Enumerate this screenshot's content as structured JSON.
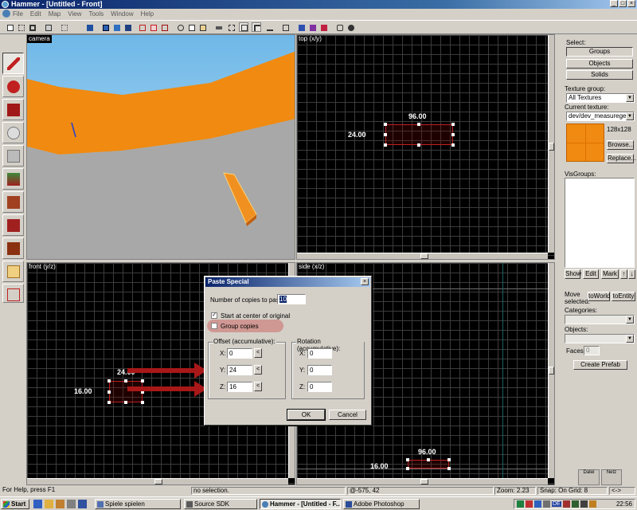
{
  "window": {
    "title": "Hammer - [Untitled - Front]",
    "min": "_",
    "max": "□",
    "close": "×"
  },
  "menu": [
    "File",
    "Edit",
    "Map",
    "View",
    "Tools",
    "Window",
    "Help"
  ],
  "viewports": {
    "camera": {
      "label": "camera"
    },
    "top": {
      "label": "top (x/y)",
      "width_label": "96.00",
      "height_label": "24.00"
    },
    "front": {
      "label": "front (y/z)",
      "width_label": "24.00",
      "height_label": "16.00"
    },
    "side": {
      "label": "side (x/z)",
      "width_label": "96.00",
      "height_label": "16.00"
    }
  },
  "right_panel": {
    "select_label": "Select:",
    "groups": "Groups",
    "objects": "Objects",
    "solids": "Solids",
    "texture_group_label": "Texture group:",
    "texture_group_value": "All Textures",
    "current_texture_label": "Current texture:",
    "current_texture_value": "dev/dev_measuregene",
    "texture_size": "128x128",
    "texture_color": "#f08a10",
    "browse": "Browse...",
    "replace": "Replace...",
    "visgroups_label": "VisGroups:",
    "show": "Show",
    "edit": "Edit",
    "mark": "Mark",
    "up": "↑",
    "down": "↓",
    "move_selected": "Move selected:",
    "to_world": "toWorld",
    "to_entity": "toEntity",
    "categories_label": "Categories:",
    "objects_label": "Objects:",
    "faces_label": "Faces:",
    "faces_value": "0",
    "create_prefab": "Create Prefab",
    "mini_tab_1": "Datei",
    "mini_tab_2": "Netz"
  },
  "dialog": {
    "title": "Paste Special",
    "close": "×",
    "copies_label": "Number of copies to paste:",
    "copies_value": "10",
    "start_center_label": "Start at center of original",
    "start_center_checked": true,
    "group_copies_label": "Group copies",
    "group_copies_checked": false,
    "offset_title": "Offset (accumulative):",
    "rotation_title": "Rotation (accumulative):",
    "x_label": "X:",
    "y_label": "Y:",
    "z_label": "Z:",
    "offset": {
      "x": "0",
      "y": "24",
      "z": "16"
    },
    "rotation": {
      "x": "0",
      "y": "0",
      "z": "0"
    },
    "pick_button": "<",
    "ok": "OK",
    "cancel": "Cancel"
  },
  "status_bar": {
    "help": "For Help, press F1",
    "selection": "no selection.",
    "coords": "@-575, 42",
    "zoom": "Zoom: 2.23",
    "snap": "Snap: On Grid: 8",
    "extra": "<->"
  },
  "taskbar": {
    "start": "Start",
    "tasks": [
      "Spiele spielen",
      "Source SDK",
      "Hammer - [Untitled - F...",
      "Adobe Photoshop"
    ],
    "lang": "DE",
    "clock": "22:56"
  },
  "colors": {
    "title_blue": "#0a246a",
    "brush_orange": "#f08a10",
    "selection_red": "#c02020",
    "highlight_red": "#c83030"
  }
}
